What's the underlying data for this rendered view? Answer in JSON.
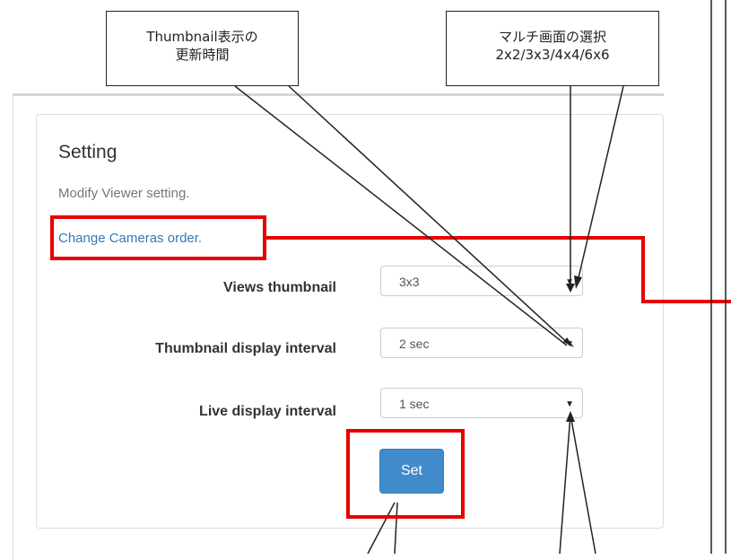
{
  "panel": {
    "title": "Setting",
    "subtitle": "Modify Viewer setting.",
    "link_text": "Change Cameras order."
  },
  "fields": [
    {
      "label": "Views thumbnail",
      "value": "3x3"
    },
    {
      "label": "Thumbnail display interval",
      "value": "2 sec"
    },
    {
      "label": "Live display interval",
      "value": "1 sec"
    }
  ],
  "set_button_label": "Set",
  "callouts": {
    "thumbnail": {
      "line1": "Thumbnail表示の",
      "line2": "更新時間"
    },
    "multiscreen": {
      "line1": "マルチ画面の選択",
      "line2": "2x2/3x3/4x4/6x6"
    }
  },
  "icons": {
    "dropdown": "chevron-down-icon"
  },
  "colors": {
    "highlight": "#e60000",
    "link": "#337ab7",
    "button": "#428bca"
  }
}
